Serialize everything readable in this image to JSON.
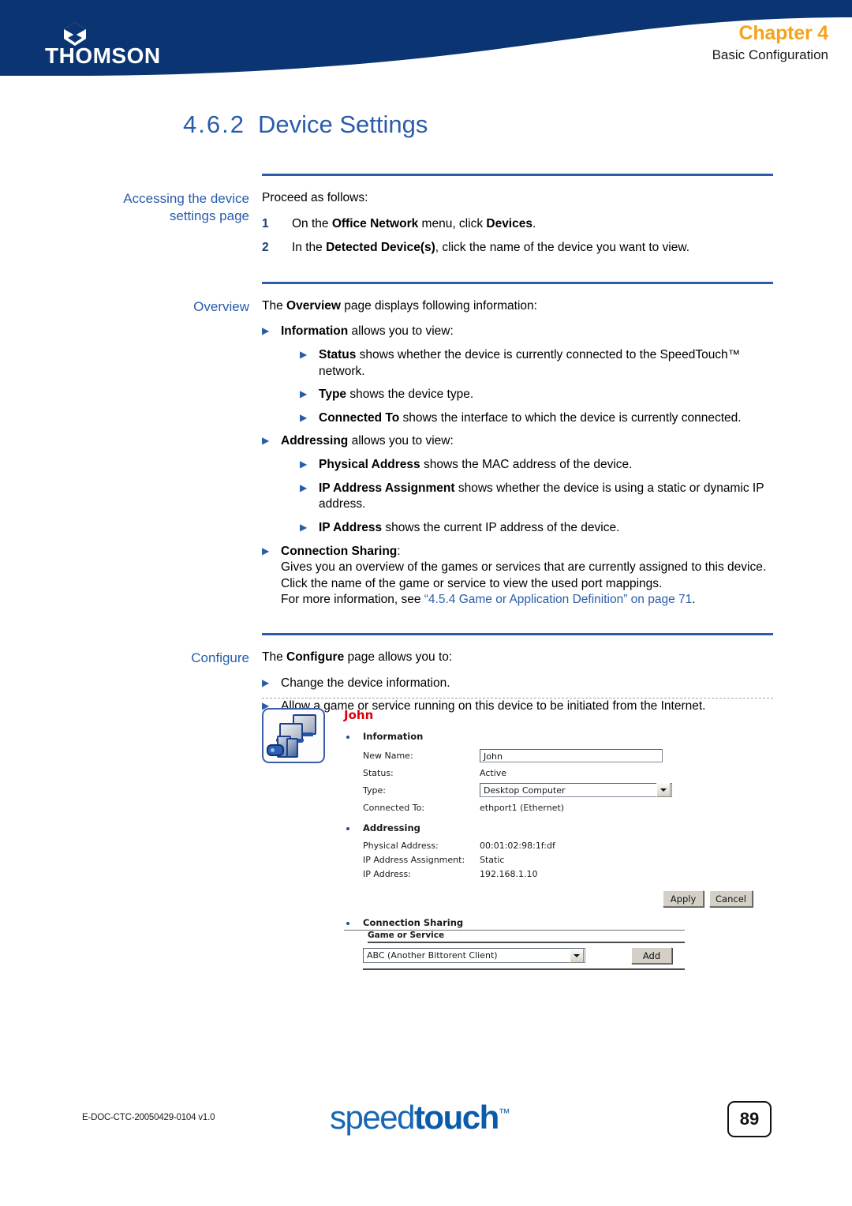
{
  "header": {
    "brand": "THOMSON",
    "chapter": "Chapter 4",
    "chapter_subtitle": "Basic Configuration",
    "brand_color": "#0B3572",
    "chapter_color": "#F5A31A"
  },
  "section": {
    "number": "4.6.2",
    "title": "Device Settings",
    "heading_color": "#2A5CAA"
  },
  "blocks": {
    "accessing": {
      "gutter_line1": "Accessing the device",
      "gutter_line2": "settings page",
      "lead": "Proceed as follows:",
      "steps": [
        {
          "num": "1",
          "pre": "On the ",
          "b1": "Office Network",
          "mid": " menu, click ",
          "b2": "Devices",
          "post": "."
        },
        {
          "num": "2",
          "pre": "In the ",
          "b1": "Detected Device(s)",
          "mid": ", click the name of the device you want to view.",
          "b2": "",
          "post": ""
        }
      ]
    },
    "overview": {
      "gutter": "Overview",
      "lead_pre": "The ",
      "lead_bold": "Overview",
      "lead_post": " page displays following information:",
      "items": [
        {
          "level": 1,
          "bold": "Information",
          "rest": " allows you to view:"
        },
        {
          "level": 2,
          "bold": "Status",
          "rest": " shows whether the device is currently connected to the SpeedTouch™ network."
        },
        {
          "level": 2,
          "bold": "Type",
          "rest": " shows the device type."
        },
        {
          "level": 2,
          "bold": "Connected To",
          "rest": " shows the interface to which the device is currently connected."
        },
        {
          "level": 1,
          "bold": "Addressing",
          "rest": " allows you to view:"
        },
        {
          "level": 2,
          "bold": "Physical Address",
          "rest": " shows the MAC address of the device."
        },
        {
          "level": 2,
          "bold": "IP Address Assignment",
          "rest": " shows whether the device is using a static or dynamic IP address."
        },
        {
          "level": 2,
          "bold": "IP Address",
          "rest": " shows the current IP address of the device."
        }
      ],
      "connection_sharing": {
        "bold": "Connection Sharing",
        "colon": ":",
        "paragraph": "Gives you an overview of the games or services that are currently assigned to this device. Click the name of the game or service to view the used port mappings.",
        "xref_pre": "For more information, see ",
        "xref_link": "“4.5.4 Game or Application Definition” on page 71",
        "xref_post": "."
      }
    },
    "configure": {
      "gutter": "Configure",
      "lead_pre": "The ",
      "lead_bold": "Configure",
      "lead_post": " page allows you to:",
      "items": [
        "Change the device information.",
        "Allow a game or service running on this device to be initiated from the Internet."
      ]
    }
  },
  "ui_screenshot": {
    "device_icon_name": "desktop-computer-icon",
    "device_name": "John",
    "device_name_color": "#d6000b",
    "information": {
      "group_label": "Information",
      "rows": [
        {
          "label": "New Name:",
          "value": "John",
          "control": "textbox"
        },
        {
          "label": "Status:",
          "value": "Active",
          "control": "text"
        },
        {
          "label": "Type:",
          "value": "Desktop Computer",
          "control": "select"
        },
        {
          "label": "Connected To:",
          "value": "ethport1 (Ethernet)",
          "control": "text"
        }
      ]
    },
    "addressing": {
      "group_label": "Addressing",
      "rows": [
        {
          "label": "Physical Address:",
          "value": "00:01:02:98:1f:df",
          "control": "text"
        },
        {
          "label": "IP Address Assignment:",
          "value": "Static",
          "control": "text"
        },
        {
          "label": "IP Address:",
          "value": "192.168.1.10",
          "control": "text"
        }
      ]
    },
    "buttons": {
      "apply": "Apply",
      "cancel": "Cancel",
      "add": "Add"
    },
    "connection_sharing": {
      "title": "Connection Sharing",
      "column_header": "Game or Service",
      "selected_service": "ABC (Another Bittorent Client)"
    }
  },
  "footer": {
    "doc_id": "E-DOC-CTC-20050429-0104 v1.0",
    "logo_light": "speed",
    "logo_bold": "touch",
    "logo_tm": "™",
    "page_number": "89",
    "logo_color": "#1767b5"
  }
}
